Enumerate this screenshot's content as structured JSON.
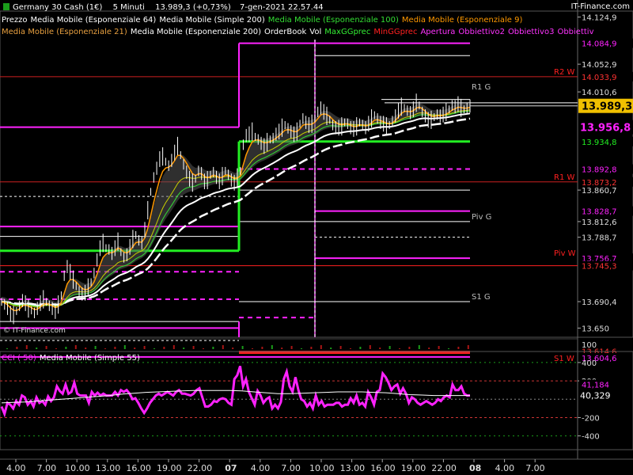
{
  "header": {
    "instrument": "Germany 30 Cash (1€)",
    "timeframe": "5 Minuti",
    "last": "13.989,3 (+0,73%)",
    "datetime": "7-gen-2021 22.57.44",
    "brand": "IT-Finance.com",
    "watermark": "© IT-Finance.com"
  },
  "legend_row1": [
    {
      "text": "Prezzo",
      "color": "#ffffff"
    },
    {
      "text": "Media Mobile (Esponenziale 64)",
      "color": "#ffffff"
    },
    {
      "text": "Media Mobile (Simple 200)",
      "color": "#ffffff"
    },
    {
      "text": "Media Mobile (Esponenziale 100)",
      "color": "#33dd33"
    },
    {
      "text": "Media Mobile (Esponenziale 9)",
      "color": "#ff9900"
    }
  ],
  "legend_row2": [
    {
      "text": "Media Mobile (Esponenziale 21)",
      "color": "#e8a040"
    },
    {
      "text": "Media Mobile (Esponenziale 200)",
      "color": "#ffffff"
    },
    {
      "text": "OrderBook",
      "color": "#ffffff"
    },
    {
      "text": "Vol",
      "color": "#ffffff"
    },
    {
      "text": "MaxGGprec",
      "color": "#33ee33"
    },
    {
      "text": "MinGGprec",
      "color": "#ff2020"
    },
    {
      "text": "Apertura",
      "color": "#ff33ff"
    },
    {
      "text": "Obbiettivo2",
      "color": "#ff33ff"
    },
    {
      "text": "Obbiettivo3",
      "color": "#ff33ff"
    },
    {
      "text": "Obbiettiv",
      "color": "#ff33ff"
    }
  ],
  "sub_legend": [
    {
      "text": "CCI ( 50)",
      "color": "#ff33ff"
    },
    {
      "text": "Media Mobile (Simple 55)",
      "color": "#ffffff"
    }
  ],
  "colors": {
    "background": "#000000",
    "magenta": "#ff22ff",
    "green": "#22ee22",
    "red": "#ff2020",
    "pivot_red": "#cc2020",
    "white": "#ffffff",
    "current_price_bg": "#f0c000"
  },
  "chart_data": [
    {
      "type": "line",
      "title": "Germany 30 Cash (1€) 5 Minuti",
      "ylim": [
        13636,
        14134
      ],
      "y_ticks": [
        "14.124,9",
        "14.052,9",
        "14.010,6",
        "13.860,7",
        "13.812,6",
        "13.788,7",
        "13.690,4",
        "13.650"
      ],
      "x_ticks": [
        "4.00",
        "7.00",
        "10.00",
        "13.00",
        "16.00",
        "19.00",
        "22.00",
        "07",
        "4.00",
        "7.00",
        "10.00",
        "13.00",
        "16.00",
        "19.00",
        "22.00",
        "08",
        "4.00",
        "7.00"
      ],
      "level_labels": [
        {
          "value": 14084.9,
          "text": "14.084,9",
          "color": "#ff22ff"
        },
        {
          "value": 14033.9,
          "text": "14.033,9",
          "color": "#ff3333"
        },
        {
          "value": 13956.8,
          "text": "13.956,8",
          "color": "#ff22ff"
        },
        {
          "value": 13934.8,
          "text": "13.934,8",
          "color": "#22ee22"
        },
        {
          "value": 13892.8,
          "text": "13.892,8",
          "color": "#ff22ff"
        },
        {
          "value": 13873.2,
          "text": "13.873,2",
          "color": "#ff3333"
        },
        {
          "value": 13828.7,
          "text": "13.828,7",
          "color": "#ff22ff"
        },
        {
          "value": 13756.7,
          "text": "13.756,7",
          "color": "#ff22ff"
        },
        {
          "value": 13745.3,
          "text": "13.745,3",
          "color": "#ff3333"
        },
        {
          "value": 13614.6,
          "text": "13.614,6",
          "color": "#ff3333"
        },
        {
          "value": 13604.6,
          "text": "13.604,6",
          "color": "#ff22ff"
        }
      ],
      "current_price": {
        "value": 13989.3,
        "text": "13.989,3"
      },
      "pivot_labels": [
        {
          "text": "R2 W",
          "value": 14033.9
        },
        {
          "text": "R1 G",
          "value": 14010.6
        },
        {
          "text": "R1 W",
          "value": 13873.2
        },
        {
          "text": "Piv G",
          "value": 13812.6
        },
        {
          "text": "Piv W",
          "value": 13756.7
        },
        {
          "text": "S1 G",
          "value": 13690.4
        },
        {
          "text": "S1 W",
          "value": 13596
        }
      ],
      "series": [
        {
          "type": "line",
          "values": [
            13690,
            13686,
            13680,
            13672,
            13670,
            13676,
            13684,
            13692,
            13688,
            13680,
            13677,
            13673,
            13680,
            13688,
            13694,
            13690,
            13684,
            13680,
            13676,
            13686,
            13700,
            13730,
            13744,
            13736,
            13724,
            13714,
            13706,
            13702,
            13704,
            13712,
            13720,
            13734,
            13754,
            13772,
            13780,
            13772,
            13770,
            13764,
            13772,
            13782,
            13766,
            13758,
            13762,
            13774,
            13786,
            13792,
            13784,
            13780,
            13800,
            13830,
            13858,
            13880,
            13894,
            13908,
            13912,
            13904,
            13898,
            13906,
            13918,
            13928,
            13914,
            13900,
            13888,
            13878,
            13872,
            13878,
            13890,
            13886,
            13874,
            13876,
            13884,
            13888,
            13880,
            13874,
            13882,
            13890,
            13884,
            13876,
            13872,
            13880,
            13890,
            13930,
            13944,
            13946,
            13950,
            13942,
            13938,
            13932,
            13928,
            13934,
            13938,
            13940,
            13946,
            13950,
            13956,
            13960,
            13955,
            13950,
            13946,
            13950,
            13962,
            13970,
            13964,
            13960,
            13962,
            13970,
            13980,
            13986,
            13980,
            13974,
            13968,
            13960,
            13956,
            13956,
            13958,
            13964,
            13962,
            13956,
            13954,
            13958,
            13964,
            13960,
            13956,
            13962,
            13970,
            13975,
            13970,
            13964,
            13962,
            13958,
            13960,
            13966,
            13974,
            13982,
            13988,
            13986,
            13982,
            13979,
            13984,
            13994,
            13990,
            13980,
            13974,
            13968,
            13968,
            13972,
            13976,
            13974,
            13976,
            13980,
            13984,
            13990,
            13988,
            13992,
            13986,
            13984,
            13986,
            13989
          ]
        }
      ]
    },
    {
      "type": "line",
      "title": "CCI ( 50)",
      "ylim": [
        -550,
        520
      ],
      "y_ticks": [
        "400",
        "200",
        "-200",
        "-400"
      ],
      "value_labels": [
        {
          "text": "41,184",
          "color": "#ff22ff"
        },
        {
          "text": "40,329",
          "color": "#ffffff"
        }
      ],
      "volume_axis_label": "100",
      "series": [
        {
          "name": "CCI ( 50)",
          "values": [
            -80,
            -160,
            -40,
            -60,
            -100,
            -20,
            -60,
            40,
            20,
            -60,
            -20,
            -80,
            20,
            -40,
            -20,
            -60,
            30,
            -20,
            20,
            140,
            90,
            60,
            160,
            60,
            80,
            180,
            60,
            40,
            40,
            40,
            -40,
            80,
            40,
            70,
            40,
            60,
            40,
            40,
            40,
            80,
            40,
            100,
            80,
            100,
            60,
            0,
            10,
            -40,
            -100,
            -150,
            -100,
            -40,
            0,
            40,
            60,
            40,
            60,
            80,
            60,
            40,
            80,
            100,
            60,
            60,
            50,
            40,
            60,
            100,
            120,
            20,
            -80,
            -80,
            -60,
            -20,
            -30,
            0,
            10,
            0,
            -40,
            -60,
            220,
            260,
            360,
            140,
            220,
            80,
            10,
            -60,
            90,
            40,
            -40,
            0,
            20,
            -100,
            -60,
            -100,
            -30,
            220,
            300,
            140,
            80,
            240,
            100,
            0,
            -20,
            -80,
            -40,
            -100,
            40,
            -60,
            -20,
            -80,
            -60,
            -60,
            -60,
            -40,
            -40,
            -80,
            -60,
            -60,
            10,
            -40,
            40,
            -60,
            -40,
            -80,
            80,
            20,
            -60,
            80,
            100,
            280,
            240,
            180,
            100,
            140,
            160,
            60,
            120,
            60,
            -40,
            20,
            0,
            -40,
            -60,
            -40,
            -20,
            -40,
            -60,
            -40,
            0,
            -20,
            20,
            40,
            20,
            160,
            100,
            100,
            140,
            60,
            40,
            41
          ]
        },
        {
          "name": "Media Mobile (Simple 55)",
          "values": [
            -40,
            -35,
            -30,
            -20,
            -10,
            0,
            10,
            20,
            30,
            40,
            55,
            65,
            75,
            80,
            85,
            90,
            95,
            95,
            95,
            95,
            90,
            80,
            70,
            60,
            60,
            65,
            70,
            75,
            80,
            80,
            80,
            75,
            70,
            60,
            50,
            45,
            40,
            40,
            40,
            40
          ]
        }
      ]
    }
  ]
}
